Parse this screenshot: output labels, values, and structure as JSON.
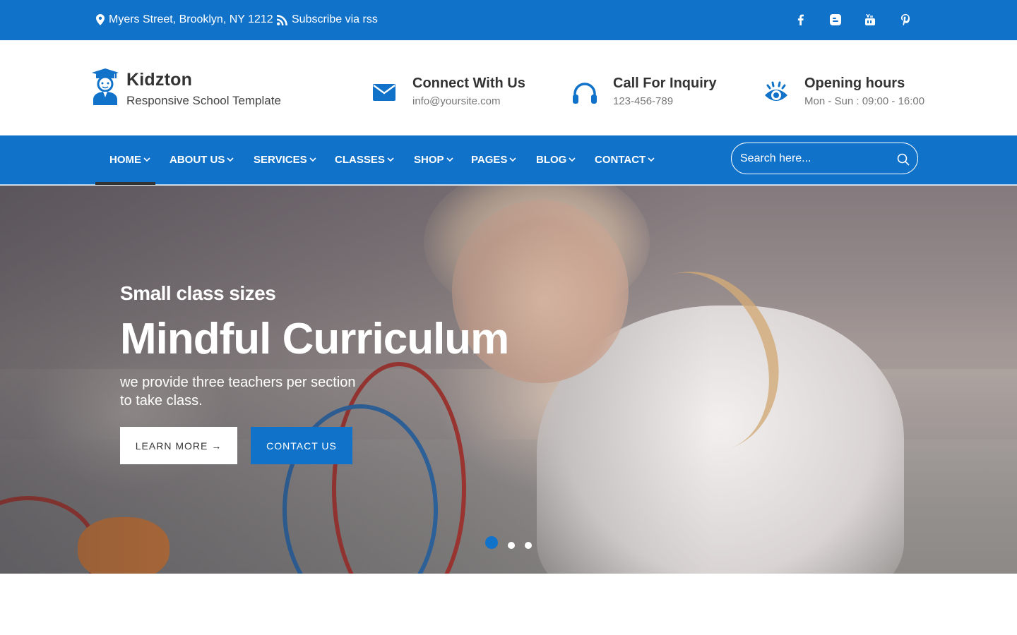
{
  "topbar": {
    "address": "Myers Street, Brooklyn, NY 1212",
    "rss": "Subscribe via rss",
    "social": [
      "facebook-icon",
      "blogger-icon",
      "youtube-icon",
      "pinterest-icon"
    ]
  },
  "header": {
    "brand": "Kidzton",
    "tagline": "Responsive School Template",
    "info": [
      {
        "title": "Connect With Us",
        "sub": "info@yoursite.com",
        "icon": "mail-icon"
      },
      {
        "title": "Call For Inquiry",
        "sub": "123-456-789",
        "icon": "headphones-icon"
      },
      {
        "title": "Opening hours",
        "sub": "Mon - Sun : 09:00 - 16:00",
        "icon": "eye-icon"
      }
    ]
  },
  "nav": {
    "items": [
      "HOME",
      "ABOUT US",
      "SERVICES",
      "CLASSES",
      "SHOP",
      "PAGES",
      "BLOG",
      "CONTACT"
    ],
    "active": "HOME",
    "search_placeholder": "Search here..."
  },
  "hero": {
    "pre_title": "Small class sizes",
    "title": "Mindful Curriculum",
    "line1": "we provide three teachers per section",
    "line2": "to take class.",
    "learn_more": "LEARN MORE →",
    "contact_us": "CONTACT US",
    "slides_total": 3,
    "slide_active": 1
  },
  "colors": {
    "primary": "#1172c9",
    "dark": "#333333",
    "muted": "#777777"
  }
}
